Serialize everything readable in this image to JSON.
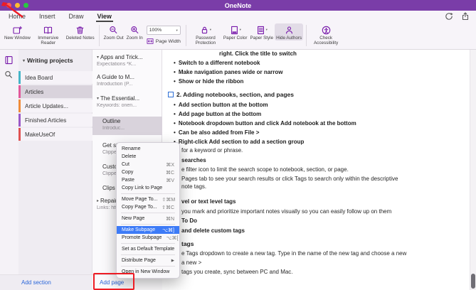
{
  "colors": {
    "titlebar": "#7a3da8",
    "accent": "#7719aa",
    "selection": "#d9d3dc",
    "menu_highlight": "#3d7bf7",
    "link": "#2b66d9",
    "annotation": "#ed1c24",
    "todo_tag": "#2e6fd6"
  },
  "icons": {
    "bullet": "•",
    "chevron_down": "▾",
    "chevron_right": "▸",
    "caret_down": "▾",
    "submenu_arrow": "▶"
  },
  "titlebar": {
    "title": "OneNote",
    "traffic_lights": [
      "#ff5f57",
      "#febc2e",
      "#28c840"
    ]
  },
  "tabs": [
    {
      "label": "Home"
    },
    {
      "label": "Insert"
    },
    {
      "label": "Draw"
    },
    {
      "label": "View"
    }
  ],
  "ribbon": {
    "zoom_value": "100%",
    "buttons": [
      {
        "label": "New Window",
        "icon": "new-window-icon"
      },
      {
        "label": "Immersive Reader",
        "icon": "immersive-reader-icon"
      },
      {
        "label": "Deleted Notes",
        "icon": "trash-icon"
      },
      {
        "label": "Zoom Out",
        "icon": "zoom-out-icon"
      },
      {
        "label": "Zoom In",
        "icon": "zoom-in-icon"
      },
      {
        "label": "Page Width",
        "icon": "page-width-icon"
      },
      {
        "label": "Password Protection",
        "icon": "lock-icon"
      },
      {
        "label": "Paper Color",
        "icon": "paper-color-icon"
      },
      {
        "label": "Paper Style",
        "icon": "paper-style-icon"
      },
      {
        "label": "Hide Authors",
        "icon": "hide-authors-icon"
      },
      {
        "label": "Check Accessibility",
        "icon": "accessibility-icon"
      }
    ]
  },
  "sidebar": {
    "header": "Writing projects",
    "sections": [
      {
        "label": "Idea Board",
        "color": "#45b5c8"
      },
      {
        "label": "Articles",
        "color": "#e2599b"
      },
      {
        "label": "Article Updates...",
        "color": "#f08c3a"
      },
      {
        "label": "Finished Articles",
        "color": "#9b59c8"
      },
      {
        "label": "MakeUseOf",
        "color": "#e05252"
      }
    ],
    "add_section": "Add section"
  },
  "pages": {
    "items": [
      {
        "title": "Apps and Trick...",
        "subtitle": "Expectations *K..."
      },
      {
        "title": "A Guide to M...",
        "subtitle": "Introduction (P..."
      },
      {
        "title": "The Essential...",
        "subtitle": "Keywords: onen..."
      },
      {
        "title": "Outline",
        "subtitle": "Introduc..."
      },
      {
        "title": "Get sta...",
        "subtitle": "Clipped f..."
      },
      {
        "title": "Custom...",
        "subtitle": "Clipped f..."
      },
      {
        "title": "Clips",
        "subtitle": ""
      },
      {
        "title": "Repairing...",
        "subtitle": "Links: htt..."
      }
    ],
    "add_page": "Add page"
  },
  "menu": {
    "items": [
      {
        "label": "Rename",
        "shortcut": ""
      },
      {
        "label": "Delete",
        "shortcut": ""
      },
      {
        "label": "Cut",
        "shortcut": "⌘X"
      },
      {
        "label": "Copy",
        "shortcut": "⌘C"
      },
      {
        "label": "Paste",
        "shortcut": "⌘V"
      },
      {
        "label": "Copy Link to Page",
        "shortcut": ""
      },
      {
        "label": "Move Page To...",
        "shortcut": "⇧⌘M"
      },
      {
        "label": "Copy Page To...",
        "shortcut": "⇧⌘C"
      },
      {
        "label": "New Page",
        "shortcut": "⌘N"
      },
      {
        "label": "Make Subpage",
        "shortcut": "⌥⌘]"
      },
      {
        "label": "Promote Subpage",
        "shortcut": "⌥⌘["
      },
      {
        "label": "Set as Default Template",
        "shortcut": ""
      },
      {
        "label": "Distribute Page",
        "shortcut": ""
      },
      {
        "label": "Open in New Window",
        "shortcut": ""
      }
    ]
  },
  "content": {
    "lines": [
      "right. Click the title to switch",
      "Switch to a different notebook",
      "Make navigation panes wide or narrow",
      "Show or hide the ribbon",
      "2.  Adding notebooks, section, and pages",
      "Add section button at the bottom",
      "Add page button at the bottom",
      "Notebook dropdown button and click Add notebook at the bottom",
      "Can be also added from File >",
      "Right-click Add section to add a section group",
      "for a keyword or phrase.",
      "searches",
      "e filter icon to limit the search scope to notebook, section, or page.",
      "Pages tab to see your search results or click Tags to search only within the descriptive",
      "note tags.",
      "vel or text level tags",
      "you mark and prioritize important notes visually so you can easily follow up on them",
      "To Do",
      "and delete custom tags",
      "tags",
      "e Tags dropdown to create a new tag. Type in the name of the new tag and choose a new",
      "a new >",
      "tags you create, sync between PC and Mac."
    ]
  }
}
